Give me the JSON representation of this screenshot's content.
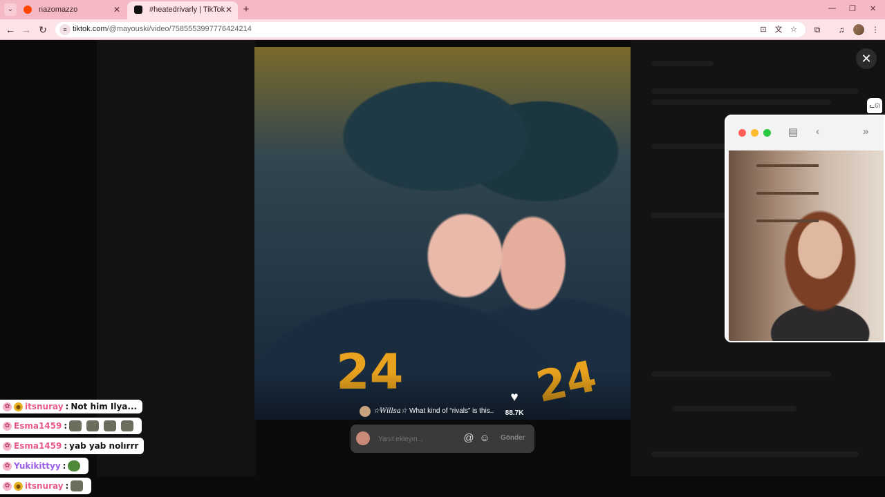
{
  "browser": {
    "tabs": [
      {
        "title": "nazomazzo",
        "active": false
      },
      {
        "title": "#heatedrivarly | TikTok",
        "active": true
      }
    ],
    "url_host": "tiktok.com",
    "url_path": "/@mayouski/video/7585553997776424214"
  },
  "video": {
    "author": "☆Willsa☆",
    "caption": "What kind of “rivals” is this..",
    "likes": "88.7K",
    "jersey_left": "24",
    "jersey_right": "24"
  },
  "reply": {
    "placeholder": "Yanıt ekleyin...",
    "send_label": "Gönder"
  },
  "chat": [
    {
      "user": "itsnuray",
      "message": "Not him Ilya...",
      "emotes": 0,
      "badges": [
        "star",
        "coin"
      ]
    },
    {
      "user": "Esma1459",
      "message": "",
      "emotes": 4,
      "badges": [
        "star"
      ]
    },
    {
      "user": "Esma1459",
      "message": "yab yab nolırrr",
      "emotes": 0,
      "badges": [
        "star"
      ]
    },
    {
      "user": "Yukikittyy",
      "message": "",
      "emotes": 1,
      "badges": [
        "star"
      ],
      "user_color": "purple"
    },
    {
      "user": "itsnuray",
      "message": "",
      "emotes": 1,
      "badges": [
        "star",
        "coin"
      ]
    }
  ],
  "colors": {
    "tabstrip": "#f4b9c4",
    "toolbar": "#fbe3e8",
    "chat_user": "#e85a8a",
    "chat_user_purple": "#9b5de5"
  }
}
